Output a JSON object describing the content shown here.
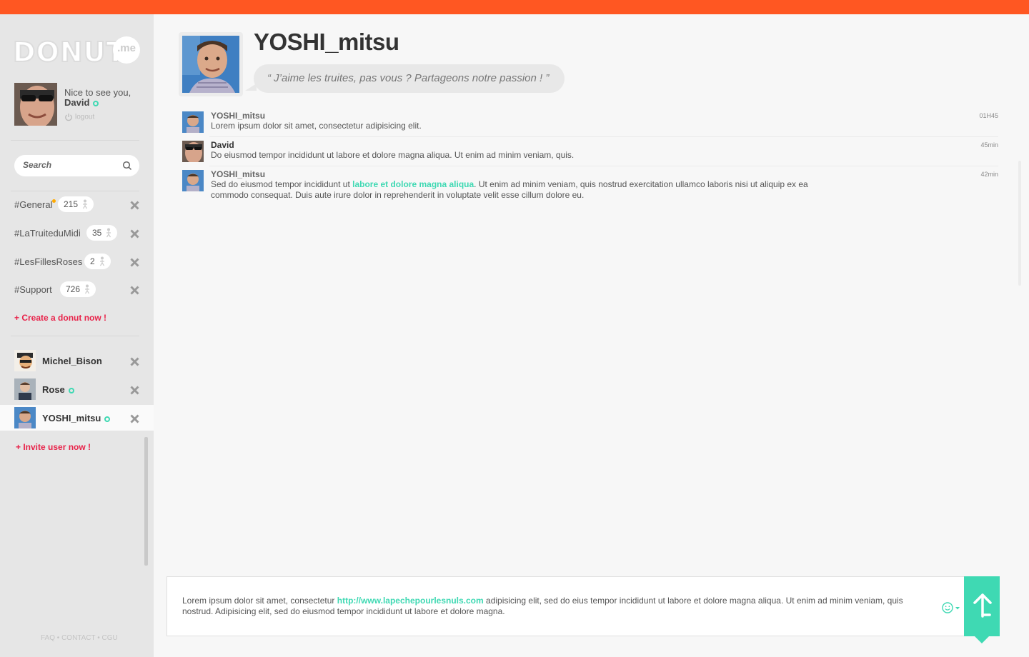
{
  "app": {
    "logo_text": "DONUT",
    "logo_suffix": ".me",
    "accent_color": "#ff5722",
    "teal_color": "#3fd9b3",
    "pink_color": "#e8234a"
  },
  "user": {
    "greeting": "Nice to see you,",
    "name": "David",
    "logout_label": "logout"
  },
  "search": {
    "placeholder": "Search"
  },
  "channels": [
    {
      "name": "#General",
      "count": "215",
      "notification": true
    },
    {
      "name": "#LaTruiteduMidi",
      "count": "35",
      "notification": false
    },
    {
      "name": "#LesFillesRoses",
      "count": "2",
      "notification": false
    },
    {
      "name": "#Support",
      "count": "726",
      "notification": false
    }
  ],
  "create_label": "+ Create a donut now !",
  "direct_messages": [
    {
      "name": "Michel_Bison",
      "online": false,
      "active": false
    },
    {
      "name": "Rose",
      "online": true,
      "active": false
    },
    {
      "name": "YOSHI_mitsu",
      "online": true,
      "active": true
    }
  ],
  "invite_label": "+ Invite user now !",
  "footer": "FAQ • CONTACT • CGU",
  "profile": {
    "name": "YOSHI_mitsu",
    "status": "“ J’aime les truites, pas vous ? Partageons notre passion ! ”"
  },
  "messages": [
    {
      "author": "YOSHI_mitsu",
      "time": "01H45",
      "text": "Lorem ipsum dolor sit amet, consectetur adipisicing elit."
    },
    {
      "author": "David",
      "time": "45min",
      "text": "Do eiusmod tempor incididunt ut labore et dolore magna aliqua. Ut enim ad minim veniam, quis."
    },
    {
      "author": "YOSHI_mitsu",
      "time": "42min",
      "text_before": "Sed do eiusmod tempor incididunt ut ",
      "text_highlight": "labore et dolore magna aliqua",
      "text_after": ". Ut enim ad minim veniam, quis nostrud exercitation ullamco laboris nisi ut aliquip ex ea commodo consequat. Duis aute irure dolor in reprehenderit in voluptate velit esse cillum dolore eu."
    }
  ],
  "composer": {
    "text_before": "Lorem ipsum dolor sit amet, consectetur ",
    "link": "http://www.lapechepourlesnuls.com",
    "text_after": " adipisicing elit, sed do eius  tempor incididunt ut labore et dolore magna aliqua. Ut enim ad minim veniam, quis nostrud. Adipisicing elit, sed do eiusmod tempor incididunt ut labore et dolore magna."
  }
}
